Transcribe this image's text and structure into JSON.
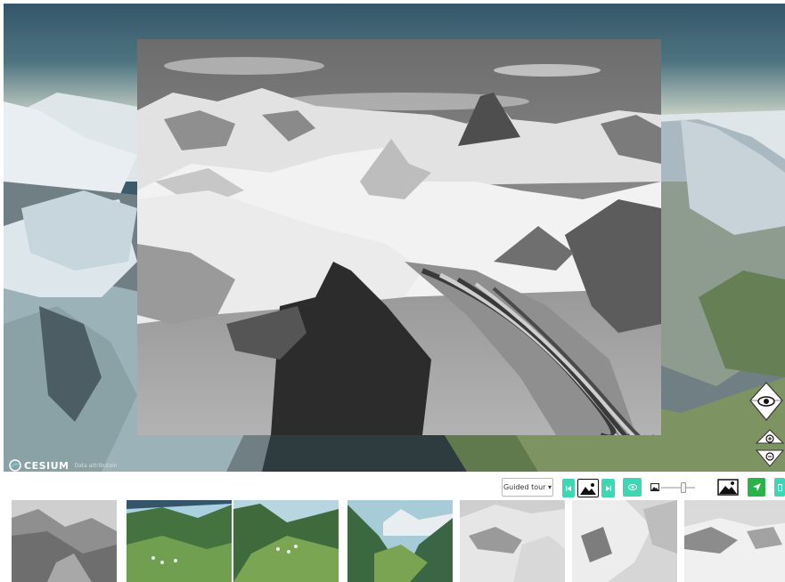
{
  "viewer": {
    "logo_text": "CESIUM",
    "credits_text": "Data attribution",
    "colors": {
      "sky_top": "#35566a",
      "sky_horizon": "#cfd6c9",
      "snow": "#e9eef2",
      "rock": "#3a4a52",
      "grass": "#6f8a5a"
    }
  },
  "controls": {
    "look_icon": "eye-icon",
    "zoom_in_icon": "zoom-in-icon",
    "zoom_out_icon": "zoom-out-icon"
  },
  "toolbar": {
    "guided_tour_label": "Guided tour ▾",
    "prev_icon": "skip-previous-icon",
    "photo_icon": "image-icon",
    "next_icon": "skip-next-icon",
    "visibility_icon": "eye-icon",
    "opacity_min_icon": "image-small-icon",
    "opacity_max_icon": "image-large-icon",
    "locate_icon": "navigation-arrow-icon",
    "opacity_value": 0.65,
    "accent_color": "#3ed6b3",
    "locate_color": "#2bb24a"
  },
  "thumbnails": [
    {
      "name": "thumbnail-1",
      "style": "bw"
    },
    {
      "name": "thumbnail-2",
      "style": "color"
    },
    {
      "name": "thumbnail-3",
      "style": "color"
    },
    {
      "name": "thumbnail-4",
      "style": "color"
    },
    {
      "name": "thumbnail-5",
      "style": "bw"
    },
    {
      "name": "thumbnail-6",
      "style": "bw"
    },
    {
      "name": "thumbnail-7",
      "style": "bw"
    }
  ]
}
